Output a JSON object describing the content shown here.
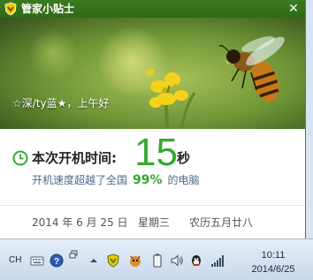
{
  "popup": {
    "title": "管家小贴士",
    "close_glyph": "✕",
    "greeting": "☆深/ty蓝★，上午好",
    "boot": {
      "label": "本次开机时间:",
      "value": "15",
      "unit": "秒",
      "speed_prefix": "开机速度超越了全国",
      "speed_percent": "99%",
      "speed_suffix": "的电脑"
    },
    "date": {
      "solar": "2014 年 6 月 25 日",
      "weekday": "星期三",
      "lunar": "农历五月廿八"
    }
  },
  "colors": {
    "titlebar": "#3b7a1d",
    "accent_green": "#36a832",
    "text_blue": "#4d6a8a"
  },
  "taskbar": {
    "language": "CH",
    "tray_icons": [
      "keyboard-icon",
      "help-icon",
      "show-hidden-icons",
      "flag-icon",
      "guanjia-shield-icon",
      "game-icon",
      "battery-icon",
      "volume-icon",
      "qq-icon",
      "network-icon"
    ],
    "clock": {
      "time": "10:11",
      "date": "2014/6/25"
    }
  }
}
